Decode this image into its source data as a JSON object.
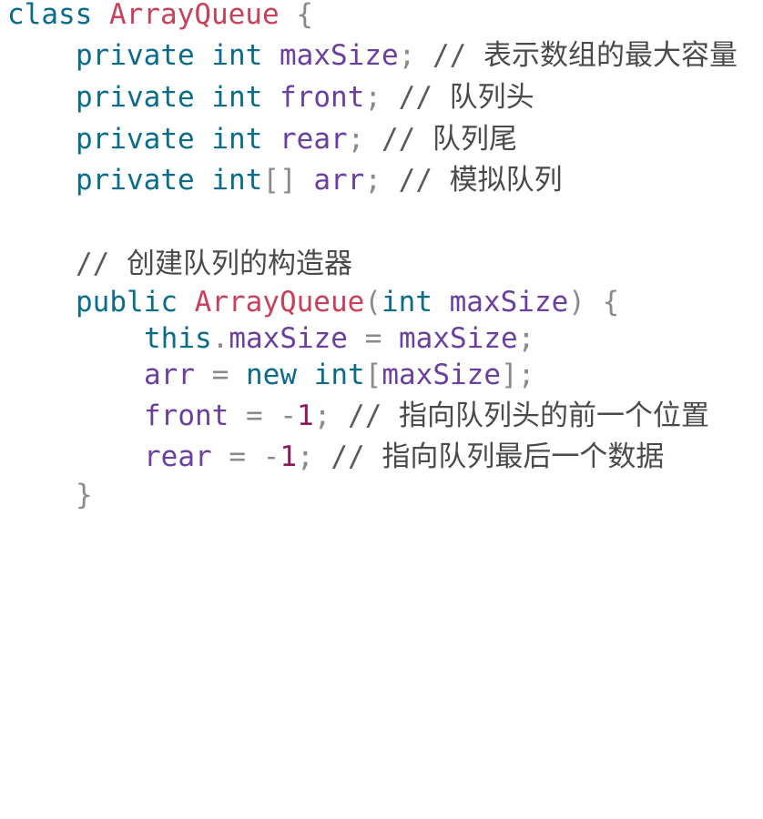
{
  "lines": {
    "l1": {
      "kw": "class",
      "cls": "ArrayQueue",
      "brace": "{"
    },
    "l2": {
      "kw1": "private",
      "kw2": "int",
      "name": "maxSize",
      "semi": ";",
      "cmt": "//",
      "cjk": "表示数组的最大容量"
    },
    "l3": {
      "kw1": "private",
      "kw2": "int",
      "name": "front",
      "semi": ";",
      "cmt": "//",
      "cjk": "队列头"
    },
    "l4": {
      "kw1": "private",
      "kw2": "int",
      "name": "rear",
      "semi": ";",
      "cmt": "//",
      "cjk": "队列尾"
    },
    "l5": {
      "kw1": "private",
      "kw2": "int",
      "br": "[]",
      "name": "arr",
      "semi": ";",
      "cmt": "//",
      "cjk": "模拟队列"
    },
    "l6": {
      "cmt": "//",
      "cjk": "创建队列的构造器"
    },
    "l7": {
      "kw": "public",
      "cls": "ArrayQueue",
      "po": "(",
      "kw2": "int",
      "name": "maxSize",
      "pc": ")",
      "brace": "{"
    },
    "l8": {
      "kw": "this",
      "dot": ".",
      "name": "maxSize",
      "eq": "=",
      "name2": "maxSize",
      "semi": ";"
    },
    "l9": {
      "name": "arr",
      "eq": "=",
      "kw": "new",
      "kw2": "int",
      "bo": "[",
      "name2": "maxSize",
      "bc": "]",
      "semi": ";"
    },
    "l10": {
      "name": "front",
      "eq": "=",
      "minus": "-",
      "num": "1",
      "semi": ";",
      "cmt": "//",
      "cjk": "指向队列头的前一个位置"
    },
    "l11": {
      "name": "rear",
      "eq": "=",
      "minus": "-",
      "num": "1",
      "semi": ";",
      "cmt": "//",
      "cjk": "指向队列最后一个数据"
    },
    "l12": {
      "brace": "}"
    }
  }
}
